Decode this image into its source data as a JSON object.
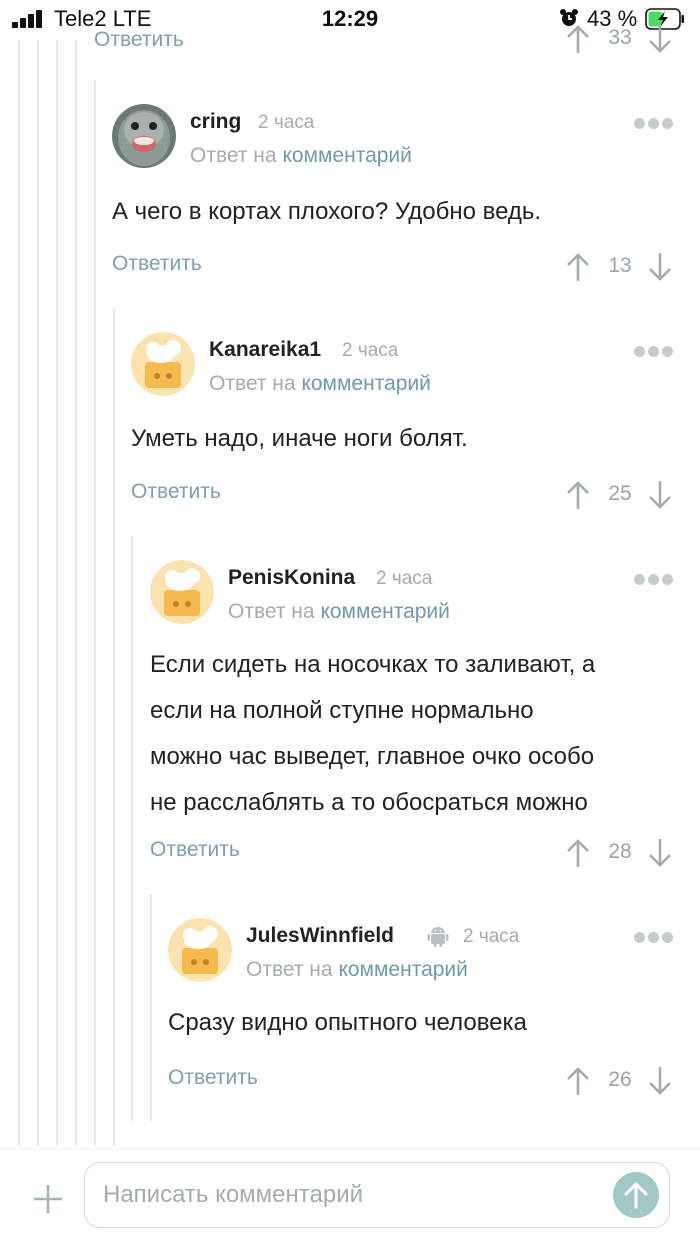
{
  "status_bar": {
    "carrier": "Tele2  LTE",
    "time": "12:29",
    "battery_percent": "43 %",
    "icons": [
      "signal-icon",
      "alarm-icon",
      "battery-charging-icon"
    ]
  },
  "top_partial": {
    "reply_label": "Ответить",
    "score": "33"
  },
  "comments": [
    {
      "author": "cring",
      "time_ago": "2 часа",
      "reply_prefix": "Ответ на",
      "reply_link": "комментарий",
      "text": "А чего в кортах плохого? Удобно ведь.",
      "reply_label": "Ответить",
      "score": "13",
      "avatar": "seal-photo"
    },
    {
      "author": "Kanareika1",
      "time_ago": "2 часа",
      "reply_prefix": "Ответ на",
      "reply_link": "комментарий",
      "text": "Уметь надо, иначе ноги болят.",
      "reply_label": "Ответить",
      "score": "25",
      "avatar": "default-chef-avatar"
    },
    {
      "author": "PenisKonina",
      "time_ago": "2 часа",
      "reply_prefix": "Ответ на",
      "reply_link": "комментарий",
      "text_lines": [
        "Если сидеть на носочках то заливают, а",
        "если на полной ступне нормально",
        "можно час выведет, главное очко особо",
        "не расслаблять а то обосраться можно"
      ],
      "reply_label": "Ответить",
      "score": "28",
      "avatar": "default-chef-avatar"
    },
    {
      "author": "JulesWinnfield",
      "time_ago": "2 часа",
      "reply_prefix": "Ответ на",
      "reply_link": "комментарий",
      "text": "Сразу видно опытного человека",
      "reply_label": "Ответить",
      "score": "26",
      "avatar": "default-chef-avatar",
      "platform_icon": "android-icon"
    }
  ],
  "composer": {
    "placeholder": "Написать комментарий"
  },
  "colors": {
    "accent_link": "#6f9aa9",
    "muted_text": "#a4acaf",
    "thread_line": "#e4e8ea",
    "send_button": "#a3c8c8",
    "avatar_bg": "#fbe3b0"
  }
}
